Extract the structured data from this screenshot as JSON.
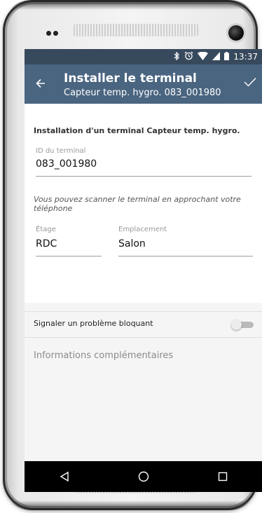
{
  "statusbar": {
    "time": "13:37"
  },
  "appbar": {
    "title": "Installer le terminal",
    "subtitle": "Capteur temp. hygro. 083_001980"
  },
  "form": {
    "heading": "Installation d'un terminal Capteur temp. hygro.",
    "terminal_id": {
      "label": "ID du terminal",
      "value": "083_001980"
    },
    "scan_hint": "Vous pouvez scanner le terminal en approchant votre téléphone",
    "floor": {
      "label": "Étage",
      "value": "RDC"
    },
    "location": {
      "label": "Emplacement",
      "value": "Salon"
    }
  },
  "blocking": {
    "label": "Signaler un problème bloquant",
    "enabled": false
  },
  "info": {
    "placeholder": "Informations complémentaires"
  },
  "colors": {
    "appbar": "#4a6580",
    "statusbar": "#37495c"
  },
  "icons": {
    "back": "arrow-left-icon",
    "confirm": "check-icon",
    "status": [
      "bluetooth-icon",
      "alarm-icon",
      "wifi-icon",
      "signal-icon",
      "battery-icon"
    ],
    "nav": [
      "back-triangle-icon",
      "home-circle-icon",
      "recents-square-icon"
    ]
  }
}
